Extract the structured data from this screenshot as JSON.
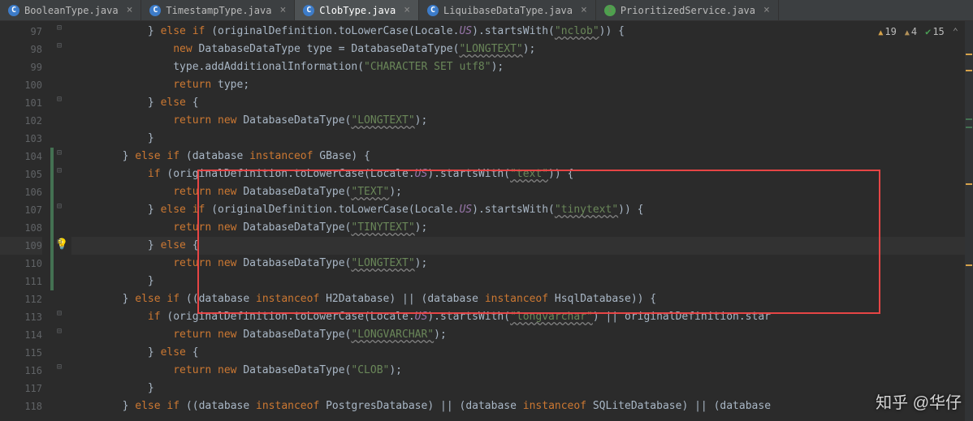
{
  "tabs": [
    {
      "icon": "C",
      "cls": "",
      "label": "BooleanType.java"
    },
    {
      "icon": "C",
      "cls": "",
      "label": "TimestampType.java"
    },
    {
      "icon": "C",
      "cls": "",
      "label": "ClobType.java",
      "active": true
    },
    {
      "icon": "C",
      "cls": "",
      "label": "LiquibaseDataType.java"
    },
    {
      "icon": "I",
      "cls": "green",
      "label": "PrioritizedService.java"
    }
  ],
  "stats": {
    "warn": "19",
    "warn2": "4",
    "check": "15"
  },
  "lines": {
    "start": 97,
    "end": 118,
    "hl": 109
  },
  "code": {
    "l97": {
      "pre": "            } ",
      "kw1": "else if ",
      "par1": "(",
      "id1": "originalDefinition",
      "m1": ".toLowerCase(",
      "loc": "Locale",
      "dot": ".",
      "us": "US",
      "par2": ").startsWith(",
      "s1": "\"nclob\"",
      "par3": ")) {"
    },
    "l98": {
      "pre": "                ",
      "t": "DatabaseDataType type = ",
      "kw": "new ",
      "cls": "DatabaseDataType(",
      "s": "\"LONGTEXT\"",
      "end": ");"
    },
    "l99": {
      "pre": "                ",
      "id": "type",
      "m": ".addAdditionalInformation(",
      "s": "\"CHARACTER SET utf8\"",
      "end": ");"
    },
    "l100": {
      "pre": "                ",
      "kw": "return ",
      "id": "type",
      "end": ";"
    },
    "l101": {
      "pre": "            } ",
      "kw": "else ",
      "end": "{"
    },
    "l102": {
      "pre": "                ",
      "kw": "return new ",
      "cls": "DatabaseDataType(",
      "s": "\"LONGTEXT\"",
      "end": ");"
    },
    "l103": {
      "pre": "            }"
    },
    "l104": {
      "pre": "        } ",
      "kw": "else if ",
      "par": "(",
      "id": "database ",
      "kw2": "instanceof ",
      "cls": "GBase",
      "end": ") {"
    },
    "l105": {
      "pre": "            ",
      "kw": "if ",
      "par": "(",
      "id": "originalDefinition",
      "m": ".toLowerCase(",
      "loc": "Locale",
      "dot": ".",
      "us": "US",
      "par2": ").startsWith(",
      "s": "\"text\"",
      "end": ")) {"
    },
    "l106": {
      "pre": "                ",
      "kw": "return new ",
      "cls": "DatabaseDataType(",
      "s": "\"TEXT\"",
      "end": ");"
    },
    "l107": {
      "pre": "            } ",
      "kw": "else if ",
      "par": "(",
      "id": "originalDefinition",
      "m": ".toLowerCase(",
      "loc": "Locale",
      "dot": ".",
      "us": "US",
      "par2": ").startsWith(",
      "s": "\"tinytext\"",
      "end": ")) {"
    },
    "l108": {
      "pre": "                ",
      "kw": "return new ",
      "cls": "DatabaseDataType(",
      "s": "\"TINYTEXT\"",
      "end": ");"
    },
    "l109": {
      "pre": "            } ",
      "kw": "else ",
      "end": "{"
    },
    "l110": {
      "pre": "                ",
      "kw": "return new ",
      "cls": "DatabaseDataType(",
      "s": "\"LONGTEXT\"",
      "end": ");"
    },
    "l111": {
      "pre": "            ",
      "end": "}"
    },
    "l112": {
      "pre": "        } ",
      "kw": "else if ",
      "par": "((",
      "id": "database ",
      "kw2": "instanceof ",
      "cls": "H2Database",
      "mid": ") || (",
      "id2": "database ",
      "kw3": "instanceof ",
      "cls2": "HsqlDatabase",
      "end": ")) {"
    },
    "l113": {
      "pre": "            ",
      "kw": "if ",
      "par": "(",
      "id": "originalDefinition",
      "m": ".toLowerCase(",
      "loc": "Locale",
      "dot": ".",
      "us": "US",
      "par2": ").startsWith(",
      "s": "\"longvarchar\"",
      "mid": ") || ",
      "id2": "originalDefinition",
      "m2": ".star"
    },
    "l114": {
      "pre": "                ",
      "kw": "return new ",
      "cls": "DatabaseDataType(",
      "s": "\"LONGVARCHAR\"",
      "end": ");"
    },
    "l115": {
      "pre": "            } ",
      "kw": "else ",
      "end": "{"
    },
    "l116": {
      "pre": "                ",
      "kw": "return new ",
      "cls": "DatabaseDataType(",
      "s": "\"CLOB\"",
      "end": ");"
    },
    "l117": {
      "pre": "            }"
    },
    "l118": {
      "pre": "        } ",
      "kw": "else if ",
      "par": "((",
      "id": "database ",
      "kw2": "instanceof ",
      "cls": "PostgresDatabase",
      "mid": ") || (",
      "id2": "database ",
      "kw3": "instanceof ",
      "cls2": "SQLiteDatabase",
      "mid2": ") || (",
      "id3": "database"
    }
  },
  "watermark": "知乎 @华仔"
}
